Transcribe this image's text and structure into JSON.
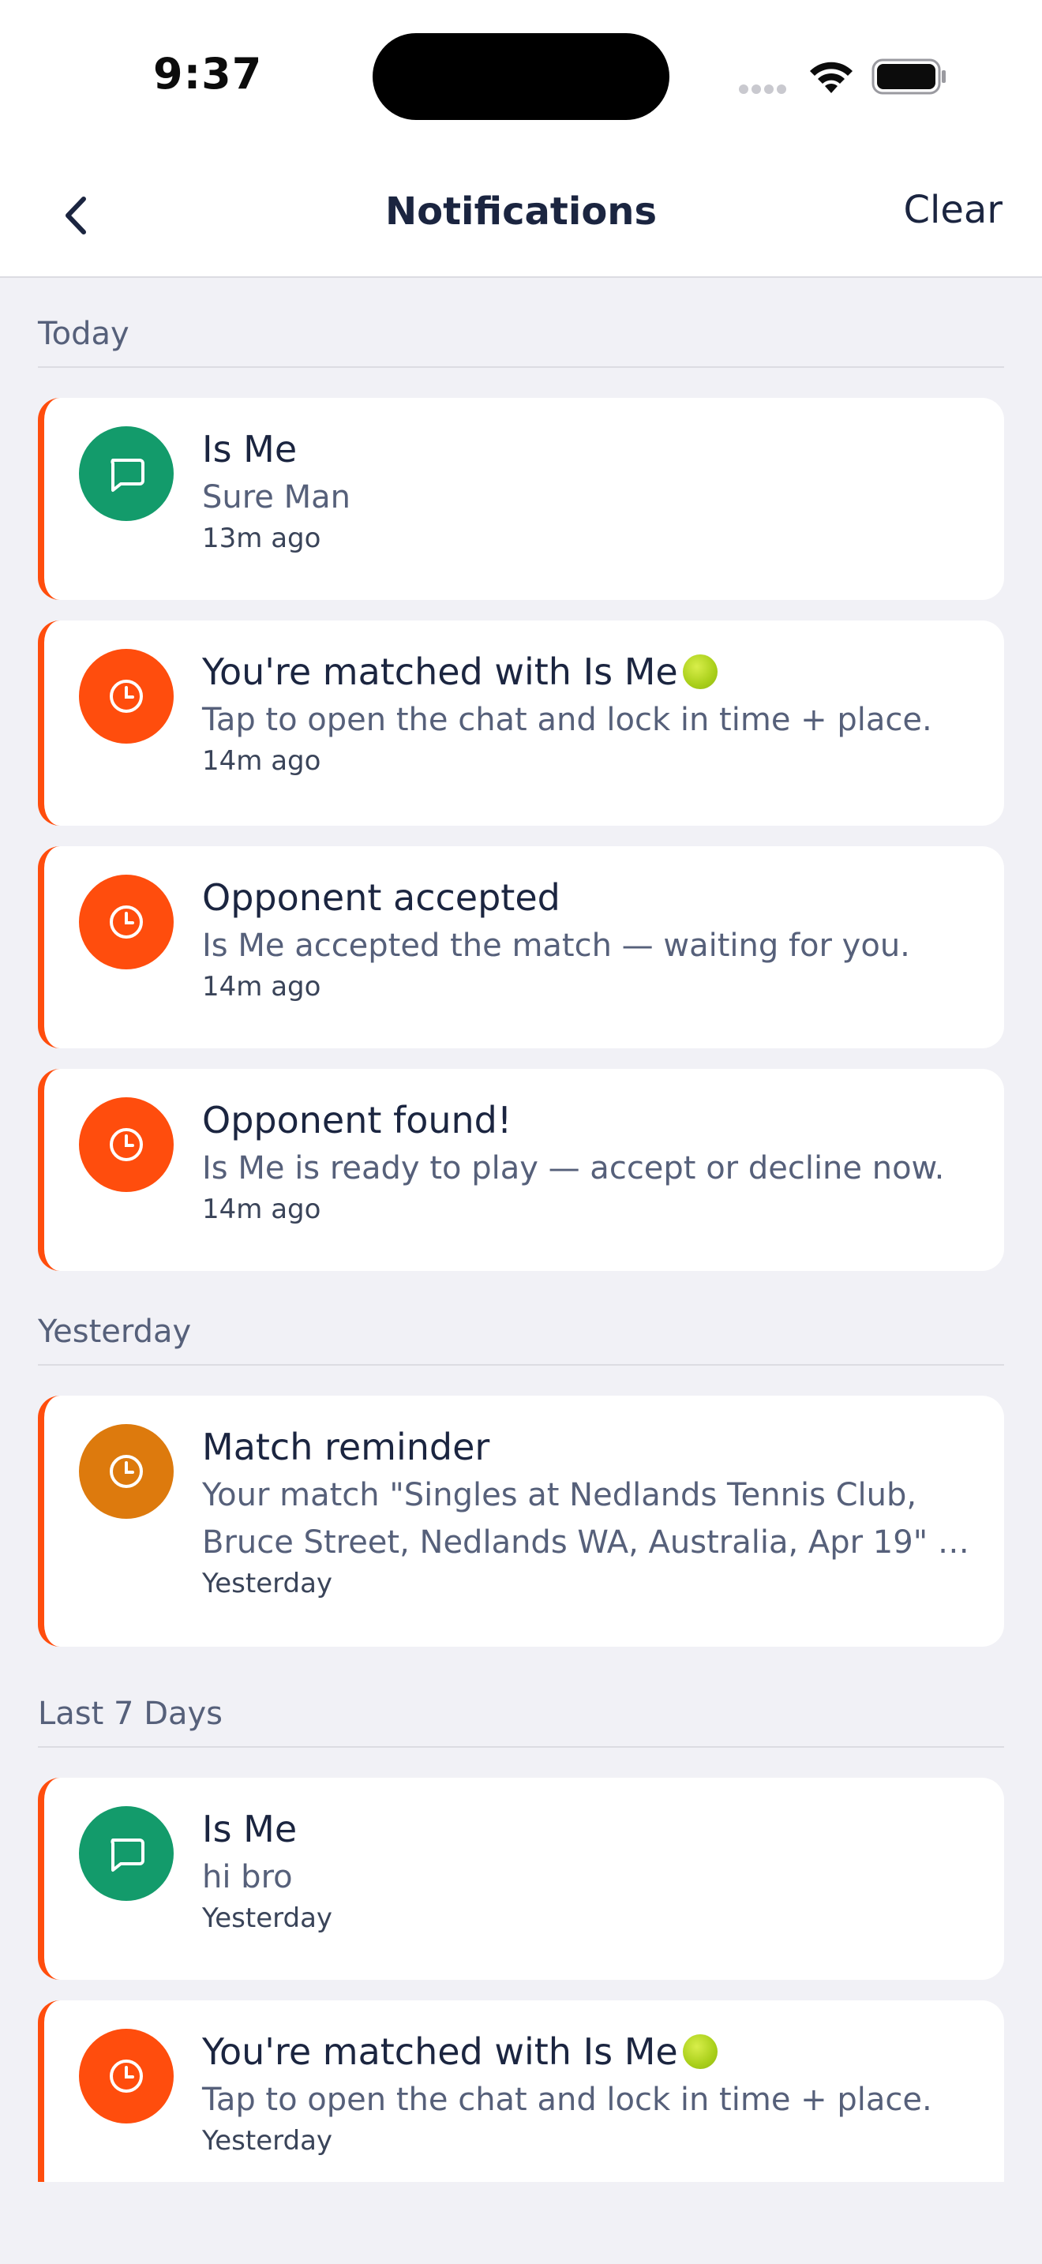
{
  "status_bar": {
    "time": "9:37"
  },
  "nav": {
    "title": "Notifications",
    "clear_label": "Clear"
  },
  "colors": {
    "accent_orange": "#ff4d0d",
    "chat_green": "#139b6b",
    "reminder_amber": "#dd7a0d",
    "text_primary": "#1b2540",
    "text_secondary": "#56607a"
  },
  "sections": [
    {
      "header": "Today",
      "items": [
        {
          "icon": "chat-bubble-icon",
          "title": "Is Me",
          "body": "Sure Man",
          "time": "13m ago"
        },
        {
          "icon": "clock-icon",
          "title": "You're matched with Is Me",
          "title_icon": "tennis-ball-icon",
          "body": "Tap to open the chat and lock in time + place.",
          "time": "14m ago"
        },
        {
          "icon": "clock-icon",
          "title": "Opponent accepted",
          "body": "Is Me accepted the match — waiting for you.",
          "time": "14m ago"
        },
        {
          "icon": "clock-icon",
          "title": "Opponent found!",
          "body": "Is Me is ready to play — accept or decline now.",
          "time": "14m ago"
        }
      ]
    },
    {
      "header": "Yesterday",
      "items": [
        {
          "icon": "clock-icon",
          "title": "Match reminder",
          "body": "Your match \"Singles at Nedlands Tennis Club, Bruce Street, Nedlands WA, Australia, Apr 19\" …",
          "time": "Yesterday"
        }
      ]
    },
    {
      "header": "Last 7 Days",
      "items": [
        {
          "icon": "chat-bubble-icon",
          "title": "Is Me",
          "body": "hi bro",
          "time": "Yesterday"
        },
        {
          "icon": "clock-icon",
          "title": "You're matched with Is Me",
          "title_icon": "tennis-ball-icon",
          "body": "Tap to open the chat and lock in time + place.",
          "time": "Yesterday"
        }
      ]
    }
  ]
}
